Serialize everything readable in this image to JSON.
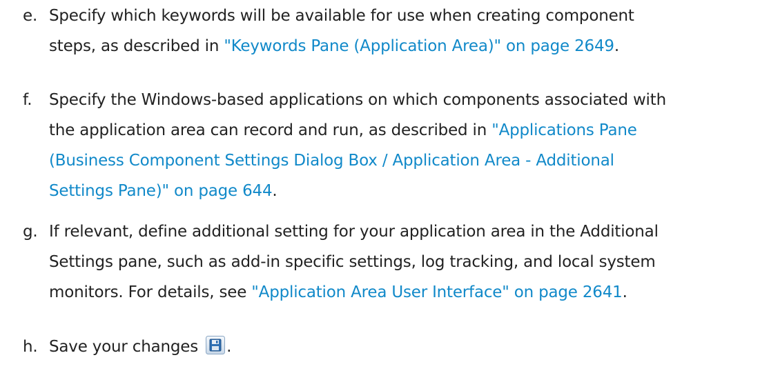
{
  "steps": [
    {
      "marker": "e.",
      "pre": "Specify which keywords will be available for use when creating component",
      "pre2": "steps, as described in ",
      "link": "\"Keywords Pane (Application Area)\" on page 2649",
      "post": "."
    },
    {
      "marker": "f.",
      "line1": "Specify the Windows-based applications on which components associated with",
      "line2_pre": "the application area can record and run, as described in ",
      "line2_link": "\"Applications Pane",
      "line3_link": "(Business Component Settings Dialog Box / Application Area - Additional",
      "line4_link": "Settings Pane)\" on page 644",
      "post": "."
    },
    {
      "marker": "g.",
      "line1": "If relevant, define additional setting for your application area in the Additional",
      "line2": "Settings pane, such as add-in specific settings, log tracking, and local system",
      "line3_pre": "monitors. For details, see ",
      "line3_link": "\"Application Area User Interface\" on page 2641",
      "post": "."
    },
    {
      "marker": "h.",
      "pre": "Save your changes",
      "icon": "save-icon",
      "post": "."
    }
  ]
}
